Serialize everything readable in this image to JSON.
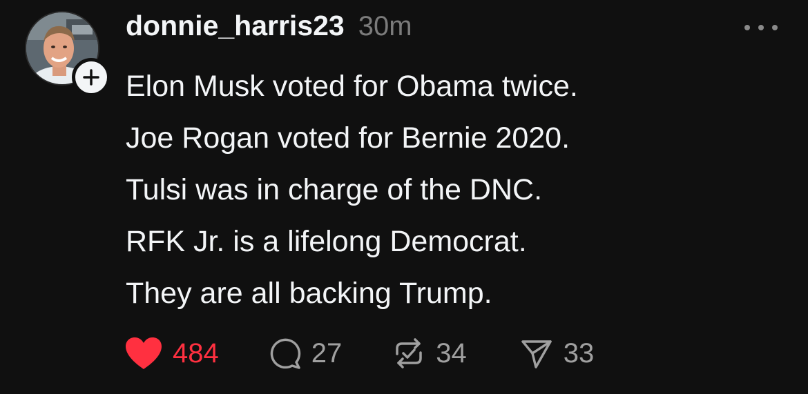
{
  "post": {
    "username": "donnie_harris23",
    "timestamp": "30m",
    "lines": [
      "Elon Musk voted for Obama twice.",
      "Joe Rogan voted for Bernie 2020.",
      "Tulsi was in charge of the DNC.",
      "RFK Jr. is a lifelong Democrat.",
      "They are all backing Trump."
    ],
    "actions": {
      "likes": "484",
      "replies": "27",
      "reposts": "34",
      "shares": "33"
    }
  },
  "icons": {
    "avatar": "profile-photo",
    "follow": "plus-icon",
    "more": "more-horizontal-icon",
    "like": "heart-filled-icon",
    "reply": "speech-bubble-icon",
    "repost": "repost-icon",
    "share": "send-paper-plane-icon"
  },
  "colors": {
    "background": "#101010",
    "text": "#f3f5f7",
    "muted": "#7b7b7b",
    "like": "#ff3040",
    "action_count": "#a0a0a0"
  }
}
